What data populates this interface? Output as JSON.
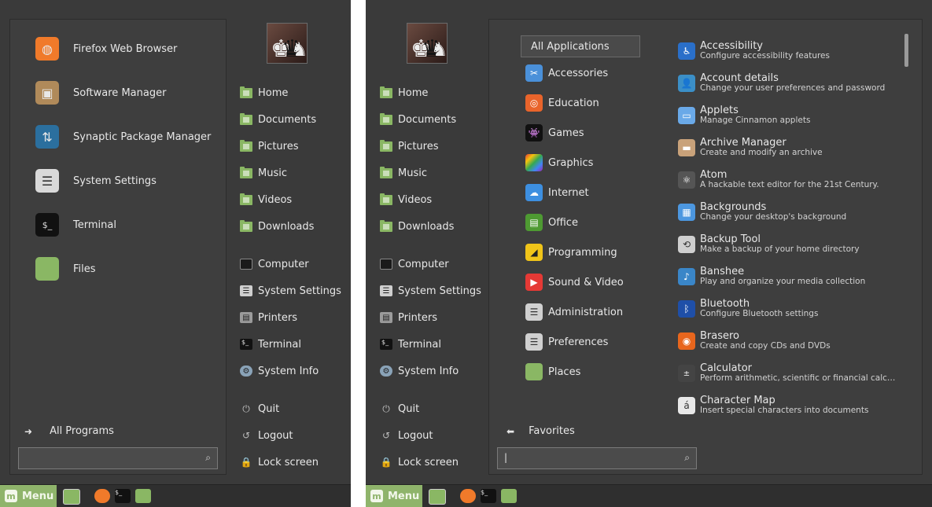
{
  "left_menu": {
    "favorites": [
      {
        "label": "Firefox Web Browser",
        "icon": "firefox-icon"
      },
      {
        "label": "Software Manager",
        "icon": "software-manager-icon"
      },
      {
        "label": "Synaptic Package Manager",
        "icon": "synaptic-icon"
      },
      {
        "label": "System Settings",
        "icon": "settings-icon"
      },
      {
        "label": "Terminal",
        "icon": "terminal-icon"
      },
      {
        "label": "Files",
        "icon": "folder-icon"
      }
    ],
    "all_programs_label": "All Programs",
    "search_value": ""
  },
  "right_menu": {
    "favorites_label": "Favorites",
    "search_value": "|",
    "categories": [
      {
        "label": "All Applications",
        "selected": true
      },
      {
        "label": "Accessories",
        "icon": "accessories-icon",
        "color": "#4a90d9"
      },
      {
        "label": "Education",
        "icon": "education-icon",
        "color": "#e9642b"
      },
      {
        "label": "Games",
        "icon": "games-icon",
        "color": "#111111"
      },
      {
        "label": "Graphics",
        "icon": "graphics-icon",
        "color": "#c0392b"
      },
      {
        "label": "Internet",
        "icon": "internet-icon",
        "color": "#3d8fe0"
      },
      {
        "label": "Office",
        "icon": "office-icon",
        "color": "#4e9a32"
      },
      {
        "label": "Programming",
        "icon": "programming-icon",
        "color": "#f0c419"
      },
      {
        "label": "Sound & Video",
        "icon": "sound-video-icon",
        "color": "#e53935"
      },
      {
        "label": "Administration",
        "icon": "administration-icon",
        "color": "#d0d0d0"
      },
      {
        "label": "Preferences",
        "icon": "preferences-icon",
        "color": "#d0d0d0"
      },
      {
        "label": "Places",
        "icon": "places-folder-icon",
        "color": "#8ab764"
      }
    ],
    "apps": [
      {
        "name": "Accessibility",
        "desc": "Configure accessibility features",
        "icon": "accessibility-icon",
        "color": "#2a6fc9"
      },
      {
        "name": "Account details",
        "desc": "Change your user preferences and password",
        "icon": "account-icon",
        "color": "#3b8fc7"
      },
      {
        "name": "Applets",
        "desc": "Manage Cinnamon applets",
        "icon": "applets-icon",
        "color": "#6aa9e8"
      },
      {
        "name": "Archive Manager",
        "desc": "Create and modify an archive",
        "icon": "archive-icon",
        "color": "#c9a27a"
      },
      {
        "name": "Atom",
        "desc": "A hackable text editor for the 21st Century.",
        "icon": "atom-icon",
        "color": "#555555"
      },
      {
        "name": "Backgrounds",
        "desc": "Change your desktop's background",
        "icon": "backgrounds-icon",
        "color": "#4c97e0"
      },
      {
        "name": "Backup Tool",
        "desc": "Make a backup of your home directory",
        "icon": "backup-icon",
        "color": "#cfcfcf"
      },
      {
        "name": "Banshee",
        "desc": "Play and organize your media collection",
        "icon": "banshee-icon",
        "color": "#3a86c8"
      },
      {
        "name": "Bluetooth",
        "desc": "Configure Bluetooth settings",
        "icon": "bluetooth-icon",
        "color": "#1f4fa8"
      },
      {
        "name": "Brasero",
        "desc": "Create and copy CDs and DVDs",
        "icon": "brasero-icon",
        "color": "#e8661d"
      },
      {
        "name": "Calculator",
        "desc": "Perform arithmetic, scientific or financial calc…",
        "icon": "calculator-icon",
        "color": "#444444"
      },
      {
        "name": "Character Map",
        "desc": "Insert special characters into documents",
        "icon": "charmap-icon",
        "color": "#e8e8e8"
      }
    ]
  },
  "places": [
    {
      "label": "Home",
      "icon": "home-folder-icon"
    },
    {
      "label": "Documents",
      "icon": "documents-folder-icon"
    },
    {
      "label": "Pictures",
      "icon": "pictures-folder-icon"
    },
    {
      "label": "Music",
      "icon": "music-folder-icon"
    },
    {
      "label": "Videos",
      "icon": "videos-folder-icon"
    },
    {
      "label": "Downloads",
      "icon": "downloads-folder-icon"
    }
  ],
  "system": [
    {
      "label": "Computer",
      "icon": "computer-icon"
    },
    {
      "label": "System Settings",
      "icon": "settings-icon"
    },
    {
      "label": "Printers",
      "icon": "printer-icon"
    },
    {
      "label": "Terminal",
      "icon": "terminal-icon"
    },
    {
      "label": "System Info",
      "icon": "system-info-icon"
    }
  ],
  "session": [
    {
      "label": "Quit",
      "icon": "power-icon"
    },
    {
      "label": "Logout",
      "icon": "logout-icon"
    },
    {
      "label": "Lock screen",
      "icon": "lock-icon"
    }
  ],
  "taskbar": {
    "menu_label": "Menu",
    "launchers": [
      "show-desktop-icon",
      "firefox-icon",
      "terminal-icon",
      "files-icon"
    ]
  }
}
